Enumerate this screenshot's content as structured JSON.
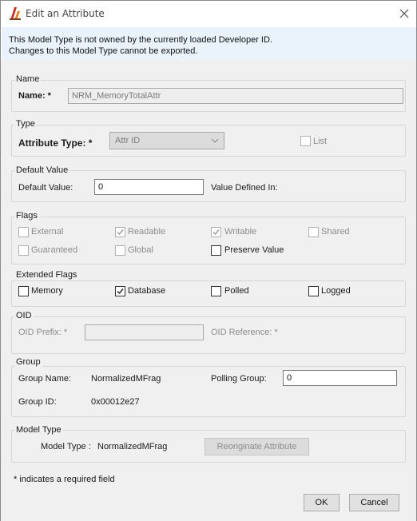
{
  "window": {
    "title": "Edit an Attribute"
  },
  "banner": {
    "line1": "This Model Type is not owned by the currently loaded Developer ID.",
    "line2": "Changes to this Model Type cannot be exported."
  },
  "name_section": {
    "title": "Name",
    "label": "Name: *",
    "value": "NRM_MemoryTotalAttr"
  },
  "type_section": {
    "title": "Type",
    "label": "Attribute Type: *",
    "selected": "Attr ID",
    "list_label": "List"
  },
  "default_section": {
    "title": "Default Value",
    "label": "Default Value:",
    "value": "0",
    "defined_in_label": "Value Defined In:"
  },
  "flags_section": {
    "title": "Flags",
    "items": [
      {
        "label": "External",
        "checked": false,
        "enabled": false
      },
      {
        "label": "Readable",
        "checked": true,
        "enabled": false
      },
      {
        "label": "Writable",
        "checked": true,
        "enabled": false
      },
      {
        "label": "Shared",
        "checked": false,
        "enabled": false
      },
      {
        "label": "Guaranteed",
        "checked": false,
        "enabled": false
      },
      {
        "label": "Global",
        "checked": false,
        "enabled": false
      },
      {
        "label": "Preserve Value",
        "checked": false,
        "enabled": true
      }
    ]
  },
  "ext_flags_section": {
    "title": "Extended Flags",
    "items": [
      {
        "label": "Memory",
        "checked": false
      },
      {
        "label": "Database",
        "checked": true
      },
      {
        "label": "Polled",
        "checked": false
      },
      {
        "label": "Logged",
        "checked": false
      }
    ]
  },
  "oid_section": {
    "title": "OID",
    "prefix_label": "OID Prefix: *",
    "prefix_value": "",
    "reference_label": "OID Reference: *"
  },
  "group_section": {
    "title": "Group",
    "name_label": "Group Name:",
    "name_value": "NormalizedMFrag",
    "polling_label": "Polling Group:",
    "polling_value": "0",
    "id_label": "Group ID:",
    "id_value": "0x00012e27"
  },
  "model_type_section": {
    "title": "Model Type",
    "label": "Model Type :",
    "value": "NormalizedMFrag",
    "reoriginate_label": "Reoriginate Attribute"
  },
  "footer": {
    "required_note": "* indicates a required field",
    "ok_label": "OK",
    "cancel_label": "Cancel"
  },
  "colors": {
    "banner_bg": "#eaf3fb",
    "panel_bg": "#f0f0f0",
    "disabled_text": "#8c8c8c"
  }
}
